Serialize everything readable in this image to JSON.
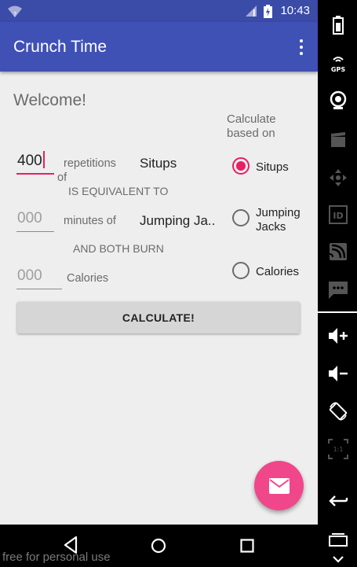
{
  "status_bar": {
    "time": "10:43"
  },
  "app_bar": {
    "title": "Crunch Time"
  },
  "content": {
    "welcome": "Welcome!",
    "calc_heading": "Calculate based on",
    "reps_value": "400",
    "reps_label": "repetitions",
    "of_label": "of",
    "exercise1": "Situps",
    "equivalent_label": "IS EQUIVALENT TO",
    "minutes_value": "000",
    "minutes_label": "minutes of",
    "exercise2": "Jumping Ja..",
    "both_burn_label": "AND BOTH BURN",
    "calories_value": "000",
    "calories_label": "Calories",
    "calculate_button": "CALCULATE!"
  },
  "radios": [
    {
      "label": "Situps",
      "checked": true
    },
    {
      "label": "Jumping Jacks",
      "checked": false
    },
    {
      "label": "Calories",
      "checked": false
    }
  ],
  "colors": {
    "primary": "#3f51b5",
    "status_bar": "#3a4ba8",
    "accent": "#e91e63",
    "fab": "#f0478a",
    "background": "#eeeeee"
  },
  "sidebar_icons": [
    "battery-icon",
    "gps-icon",
    "camera-icon",
    "video-icon",
    "move-icon",
    "id-icon",
    "cast-icon",
    "sms-icon",
    "volume-up-icon",
    "volume-down-icon",
    "rotate-icon",
    "scale-icon",
    "back-icon",
    "recents-icon",
    "chevron-down-icon"
  ],
  "watermark": "free for personal use"
}
